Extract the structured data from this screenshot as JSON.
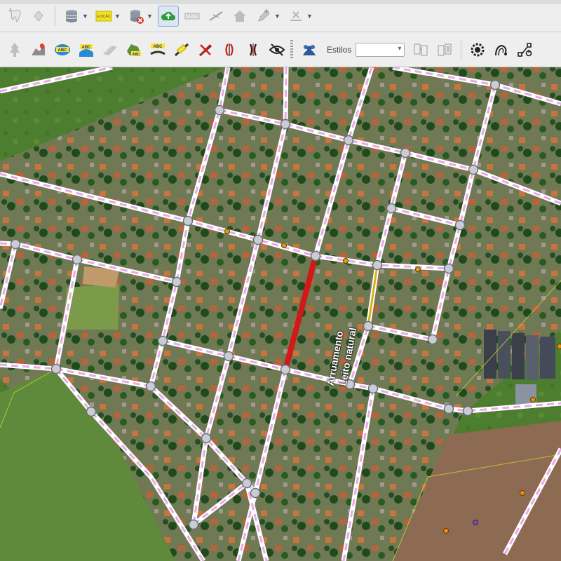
{
  "toolbar_top": {
    "buttons": [
      {
        "icon": "tooth-icon"
      },
      {
        "icon": "hand-icon"
      },
      {
        "icon": "database-icon"
      },
      {
        "icon": "edit-tag-icon",
        "text": "EDIÇÃO"
      },
      {
        "icon": "database-delete-icon"
      },
      {
        "icon": "cloud-upload-icon"
      },
      {
        "icon": "ruler-icon"
      },
      {
        "icon": "line-icon"
      },
      {
        "icon": "home-icon"
      },
      {
        "icon": "pencil-add-icon"
      },
      {
        "icon": "split-icon"
      }
    ]
  },
  "toolbar_bottom": {
    "label_buttons": [
      "ABC",
      "ABC",
      "ABC",
      "ABC"
    ],
    "styles_label": "Estilos",
    "styles_value": ""
  },
  "map": {
    "street_label_line1": "Arruamento",
    "street_label_line2": "Leito natural",
    "colors": {
      "road": "#ffffff",
      "road_dash": "#e9a9e7",
      "selected_road": "#d11919",
      "node_fill": "#c9ccd3",
      "node_stroke": "#6c6f78",
      "point": "#d9a017"
    }
  }
}
